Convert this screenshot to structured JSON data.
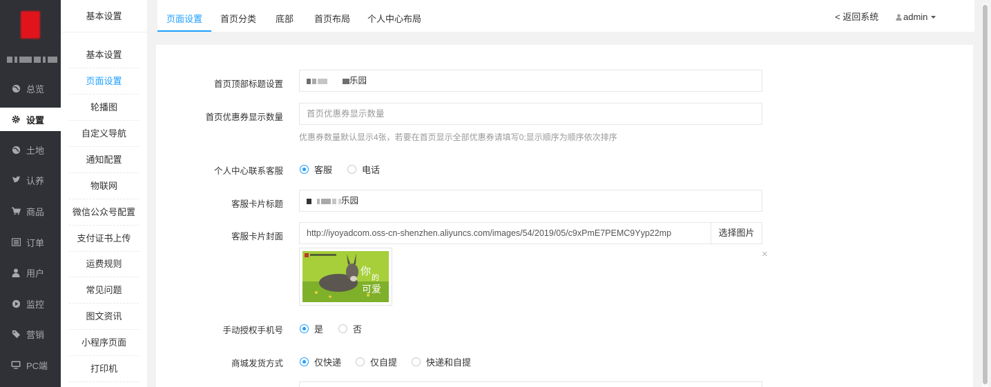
{
  "leftnav": {
    "brand_text": "",
    "items": [
      {
        "label": "总览",
        "icon": "globe-icon"
      },
      {
        "label": "设置",
        "icon": "gear-icon"
      },
      {
        "label": "土地",
        "icon": "globe-icon"
      },
      {
        "label": "认养",
        "icon": "twitter-icon"
      },
      {
        "label": "商品",
        "icon": "cart-icon"
      },
      {
        "label": "订单",
        "icon": "list-icon"
      },
      {
        "label": "用户",
        "icon": "user-icon"
      },
      {
        "label": "监控",
        "icon": "play-icon"
      },
      {
        "label": "营销",
        "icon": "tag-icon"
      },
      {
        "label": "PC端",
        "icon": "desktop-icon"
      }
    ]
  },
  "submenu": {
    "title": "基本设置",
    "items": [
      "基本设置",
      "页面设置",
      "轮播图",
      "自定义导航",
      "通知配置",
      "物联网",
      "微信公众号配置",
      "支付证书上传",
      "运费规则",
      "常见问题",
      "图文资讯",
      "小程序页面",
      "打印机"
    ]
  },
  "tabs": [
    "页面设置",
    "首页分类",
    "底部",
    "首页布局",
    "个人中心布局"
  ],
  "top_right": {
    "back": "< 返回系统",
    "user": "admin"
  },
  "form": {
    "home_title_label": "首页顶部标题设置",
    "home_title_value": "乐园",
    "coupon_label": "首页优惠券显示数量",
    "coupon_placeholder": "首页优惠券显示数量",
    "coupon_hint": "优惠券数量默认显示4张，若要在首页显示全部优惠券请填写0;显示顺序为顺序依次排序",
    "contact_label": "个人中心联系客服",
    "contact_options": [
      "客服",
      "电话"
    ],
    "card_title_label": "客服卡片标题",
    "card_title_value": "乐园",
    "card_cover_label": "客服卡片封面",
    "card_cover_value": "http://iyoyadcom.oss-cn-shenzhen.aliyuncs.com/images/54/2019/05/c9xPmE7PEMC9Yyp22mp",
    "choose_image": "选择图片",
    "close_symbol": "×",
    "phone_auth_label": "手动授权手机号",
    "phone_auth_options": [
      "是",
      "否"
    ],
    "delivery_label": "商城发货方式",
    "delivery_options": [
      "仅快递",
      "仅自提",
      "快递和自提"
    ]
  },
  "colors": {
    "accent": "#1e9fff",
    "sidebar": "#2f3136"
  }
}
